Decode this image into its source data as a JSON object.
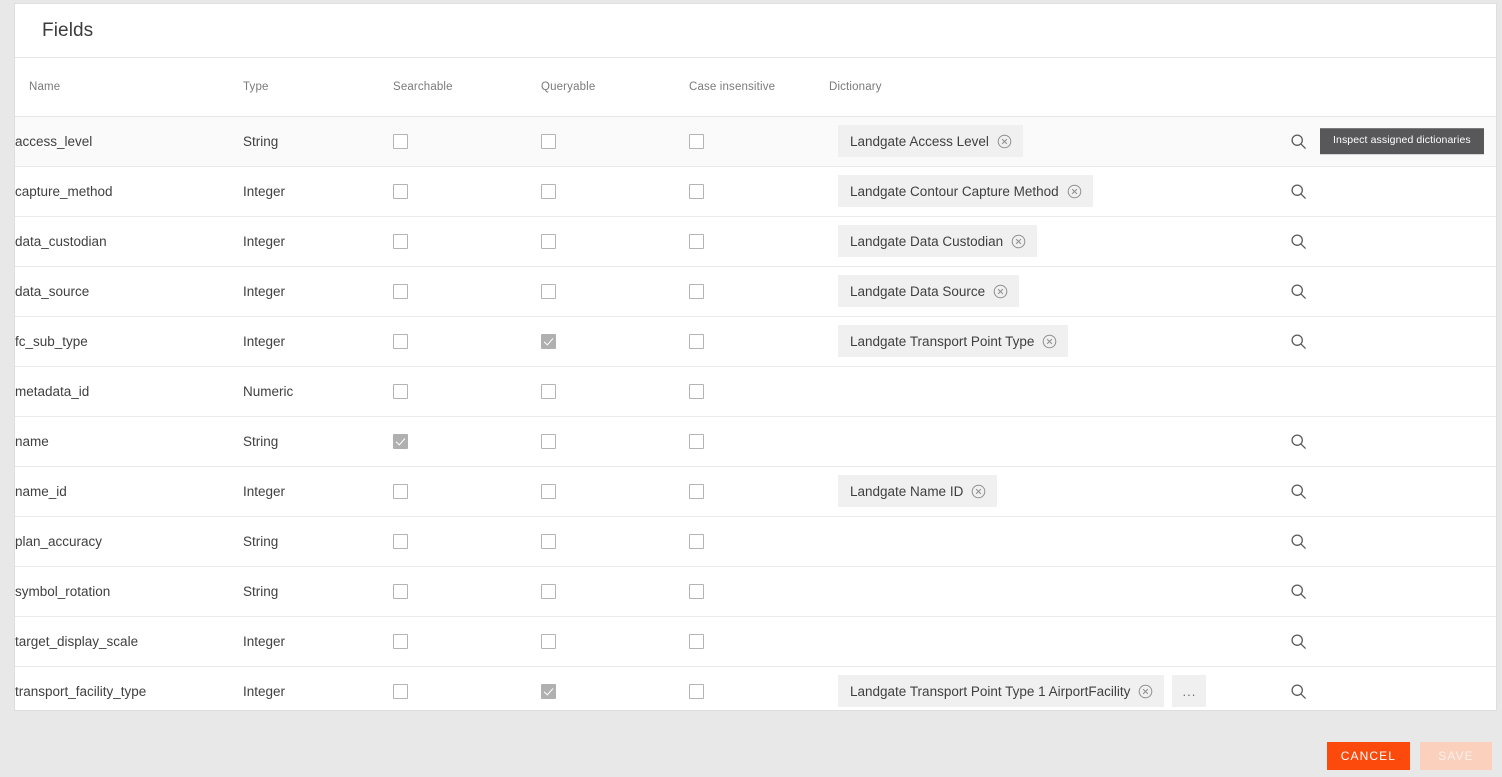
{
  "card": {
    "title": "Fields"
  },
  "table": {
    "columns": [
      {
        "key": "name",
        "label": "Name"
      },
      {
        "key": "type",
        "label": "Type"
      },
      {
        "key": "search",
        "label": "Searchable"
      },
      {
        "key": "query",
        "label": "Queryable"
      },
      {
        "key": "case",
        "label": "Case insensitive"
      },
      {
        "key": "dict",
        "label": "Dictionary"
      }
    ],
    "rows": [
      {
        "name": "access_level",
        "type": "String",
        "searchable": false,
        "queryable": false,
        "case_insensitive": false,
        "dictionaries": [
          "Landgate Access Level"
        ],
        "more": false,
        "has_search": true,
        "hovered": true
      },
      {
        "name": "capture_method",
        "type": "Integer",
        "searchable": false,
        "queryable": false,
        "case_insensitive": false,
        "dictionaries": [
          "Landgate Contour Capture Method"
        ],
        "more": false,
        "has_search": true,
        "hovered": false
      },
      {
        "name": "data_custodian",
        "type": "Integer",
        "searchable": false,
        "queryable": false,
        "case_insensitive": false,
        "dictionaries": [
          "Landgate Data Custodian"
        ],
        "more": false,
        "has_search": true,
        "hovered": false
      },
      {
        "name": "data_source",
        "type": "Integer",
        "searchable": false,
        "queryable": false,
        "case_insensitive": false,
        "dictionaries": [
          "Landgate Data Source"
        ],
        "more": false,
        "has_search": true,
        "hovered": false
      },
      {
        "name": "fc_sub_type",
        "type": "Integer",
        "searchable": false,
        "queryable": true,
        "case_insensitive": false,
        "dictionaries": [
          "Landgate Transport Point Type"
        ],
        "more": false,
        "has_search": true,
        "hovered": false
      },
      {
        "name": "metadata_id",
        "type": "Numeric",
        "searchable": false,
        "queryable": false,
        "case_insensitive": false,
        "dictionaries": [],
        "more": false,
        "has_search": false,
        "hovered": false
      },
      {
        "name": "name",
        "type": "String",
        "searchable": true,
        "queryable": false,
        "case_insensitive": false,
        "dictionaries": [],
        "more": false,
        "has_search": true,
        "hovered": false
      },
      {
        "name": "name_id",
        "type": "Integer",
        "searchable": false,
        "queryable": false,
        "case_insensitive": false,
        "dictionaries": [
          "Landgate Name ID"
        ],
        "more": false,
        "has_search": true,
        "hovered": false
      },
      {
        "name": "plan_accuracy",
        "type": "String",
        "searchable": false,
        "queryable": false,
        "case_insensitive": false,
        "dictionaries": [],
        "more": false,
        "has_search": true,
        "hovered": false
      },
      {
        "name": "symbol_rotation",
        "type": "String",
        "searchable": false,
        "queryable": false,
        "case_insensitive": false,
        "dictionaries": [],
        "more": false,
        "has_search": true,
        "hovered": false
      },
      {
        "name": "target_display_scale",
        "type": "Integer",
        "searchable": false,
        "queryable": false,
        "case_insensitive": false,
        "dictionaries": [],
        "more": false,
        "has_search": true,
        "hovered": false
      },
      {
        "name": "transport_facility_type",
        "type": "Integer",
        "searchable": false,
        "queryable": true,
        "case_insensitive": false,
        "dictionaries": [
          "Landgate Transport Point Type 1 AirportFacility"
        ],
        "more": true,
        "more_label": "...",
        "has_search": true,
        "hovered": false
      }
    ]
  },
  "tooltip": {
    "visible_on_row": 0,
    "text": "Inspect assigned dictionaries"
  },
  "icons": {
    "search": "search-icon",
    "chip_remove": "circle-close-icon",
    "more": "ellipsis-icon"
  },
  "footer": {
    "cancel_label": "CANCEL",
    "save_label": "SAVE",
    "save_disabled": true
  },
  "colors": {
    "accent": "#fb4a0c",
    "accent_disabled": "#fbd0bd",
    "tooltip_bg": "#58585a",
    "chip_bg": "#f0f0f0",
    "row_hover_bg": "#fafafa",
    "page_bg": "#e8e8e8"
  }
}
